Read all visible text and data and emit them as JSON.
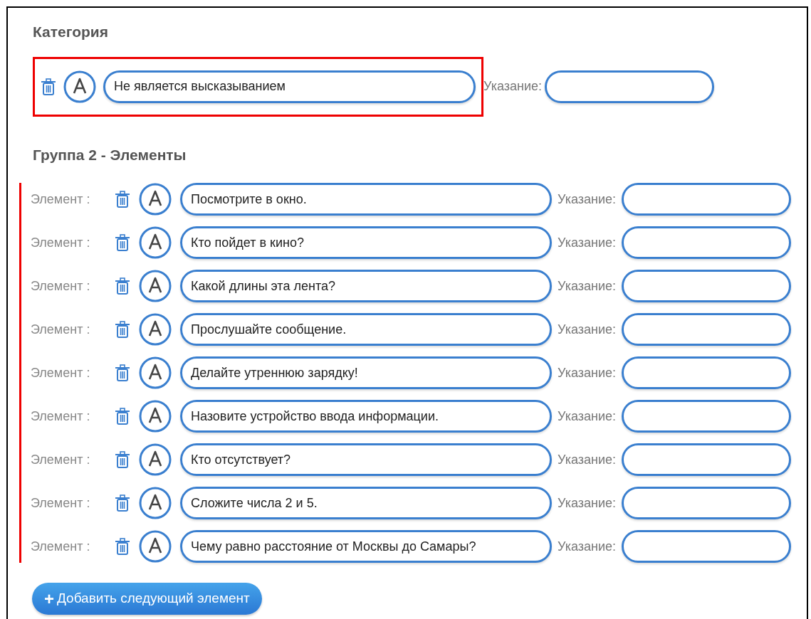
{
  "category": {
    "heading": "Категория",
    "highlighted": true,
    "value": "Не является высказыванием",
    "hint_label": "Указание:"
  },
  "group": {
    "heading": "Группа 2 - Элементы",
    "items": [
      {
        "label": "Элемент :",
        "value": "Посмотрите в окно.",
        "hint_label": "Указание:"
      },
      {
        "label": "Элемент :",
        "value": "Кто пойдет в кино?",
        "hint_label": "Указание:"
      },
      {
        "label": "Элемент :",
        "value": "Какой длины эта лента?",
        "hint_label": "Указание:"
      },
      {
        "label": "Элемент :",
        "value": "Прослушайте сообщение.",
        "hint_label": "Указание:"
      },
      {
        "label": "Элемент :",
        "value": "Делайте утреннюю зарядку!",
        "hint_label": "Указание:"
      },
      {
        "label": "Элемент :",
        "value": "Назовите устройство ввода информации.",
        "hint_label": "Указание:"
      },
      {
        "label": "Элемент :",
        "value": "Кто отсутствует?",
        "hint_label": "Указание:"
      },
      {
        "label": "Элемент :",
        "value": "Сложите числа 2 и 5.",
        "hint_label": "Указание:"
      },
      {
        "label": "Элемент :",
        "value": "Чему равно расстояние от Москвы до Самары?",
        "hint_label": "Указание:"
      }
    ]
  },
  "add_button": {
    "icon": "+",
    "label": "Добавить следующий элемент"
  }
}
